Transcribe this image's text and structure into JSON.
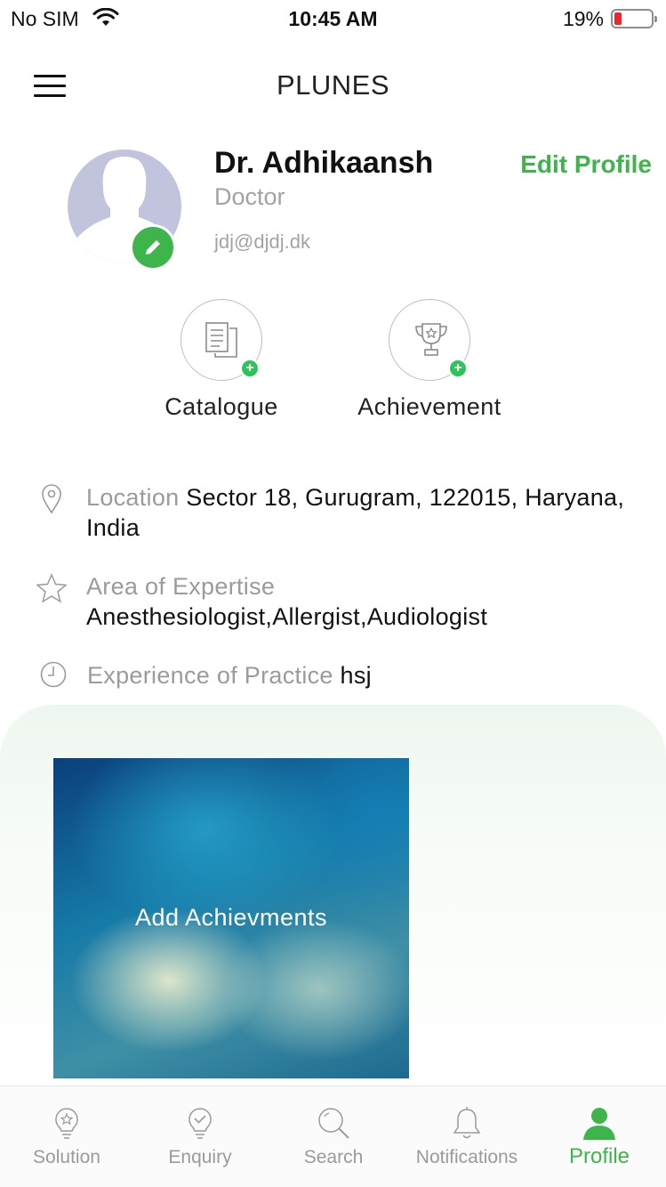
{
  "status_bar": {
    "carrier": "No SIM",
    "time": "10:45 AM",
    "battery_percent": "19%",
    "battery_level": 0.19,
    "icons": [
      "wifi-icon",
      "battery-icon"
    ]
  },
  "header": {
    "title": "PLUNES",
    "menu_icon": "hamburger-menu-icon"
  },
  "profile": {
    "name": "Dr. Adhikaansh",
    "role": "Doctor",
    "email": "jdj@djdj.dk",
    "edit_profile_label": "Edit Profile",
    "edit_photo_icon": "pencil-icon"
  },
  "actions": [
    {
      "label": "Catalogue",
      "icon": "document-icon"
    },
    {
      "label": "Achievement",
      "icon": "trophy-icon"
    }
  ],
  "info": {
    "location": {
      "label": "Location",
      "value": "Sector 18, Gurugram, 122015, Haryana, India",
      "icon": "location-pin-icon"
    },
    "expertise": {
      "label": "Area of Expertise",
      "value": "Anesthesiologist,Allergist,Audiologist",
      "icon": "star-icon"
    },
    "experience": {
      "label": "Experience of Practice",
      "value": "hsj",
      "icon": "clock-icon"
    }
  },
  "achievements_card": {
    "label": "Add Achievments"
  },
  "tabs": [
    {
      "label": "Solution",
      "icon": "lightbulb-star-icon",
      "active": false
    },
    {
      "label": "Enquiry",
      "icon": "lightbulb-check-icon",
      "active": false
    },
    {
      "label": "Search",
      "icon": "search-icon",
      "active": false
    },
    {
      "label": "Notifications",
      "icon": "bell-icon",
      "active": false
    },
    {
      "label": "Profile",
      "icon": "user-icon",
      "active": true
    }
  ],
  "colors": {
    "accent_green": "#3db54a",
    "muted_text": "#9b9b9b",
    "battery_low": "#f0262a"
  }
}
